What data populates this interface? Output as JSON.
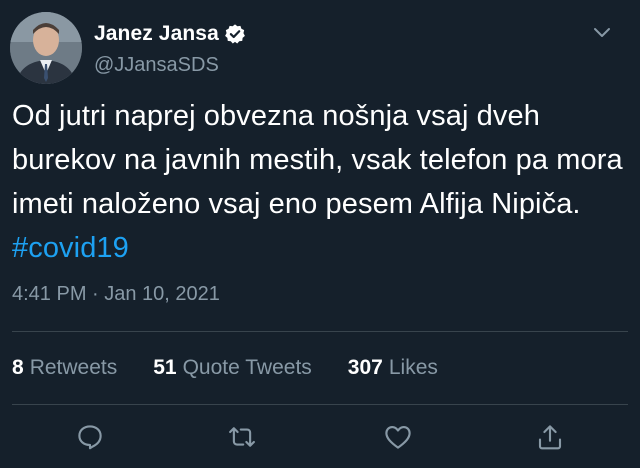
{
  "author": {
    "display_name": "Janez Jansa",
    "handle": "@JJansaSDS",
    "verified": true
  },
  "tweet": {
    "text": "Od jutri naprej obvezna nošnja vsaj dveh burekov na javnih mestih, vsak telefon pa mora imeti naloženo vsaj eno pesem Alfija Nipiča. ",
    "hashtag": "#covid19",
    "timestamp": "4:41 PM · Jan 10, 2021"
  },
  "stats": {
    "retweets_count": "8",
    "retweets_label": "Retweets",
    "quote_tweets_count": "51",
    "quote_tweets_label": "Quote Tweets",
    "likes_count": "307",
    "likes_label": "Likes"
  },
  "actions": [
    "reply-icon",
    "retweet-icon",
    "like-icon",
    "share-icon"
  ],
  "colors": {
    "background": "#15202b",
    "secondary_text": "#8899a6",
    "accent": "#1da1f2",
    "divider": "#38444d"
  }
}
